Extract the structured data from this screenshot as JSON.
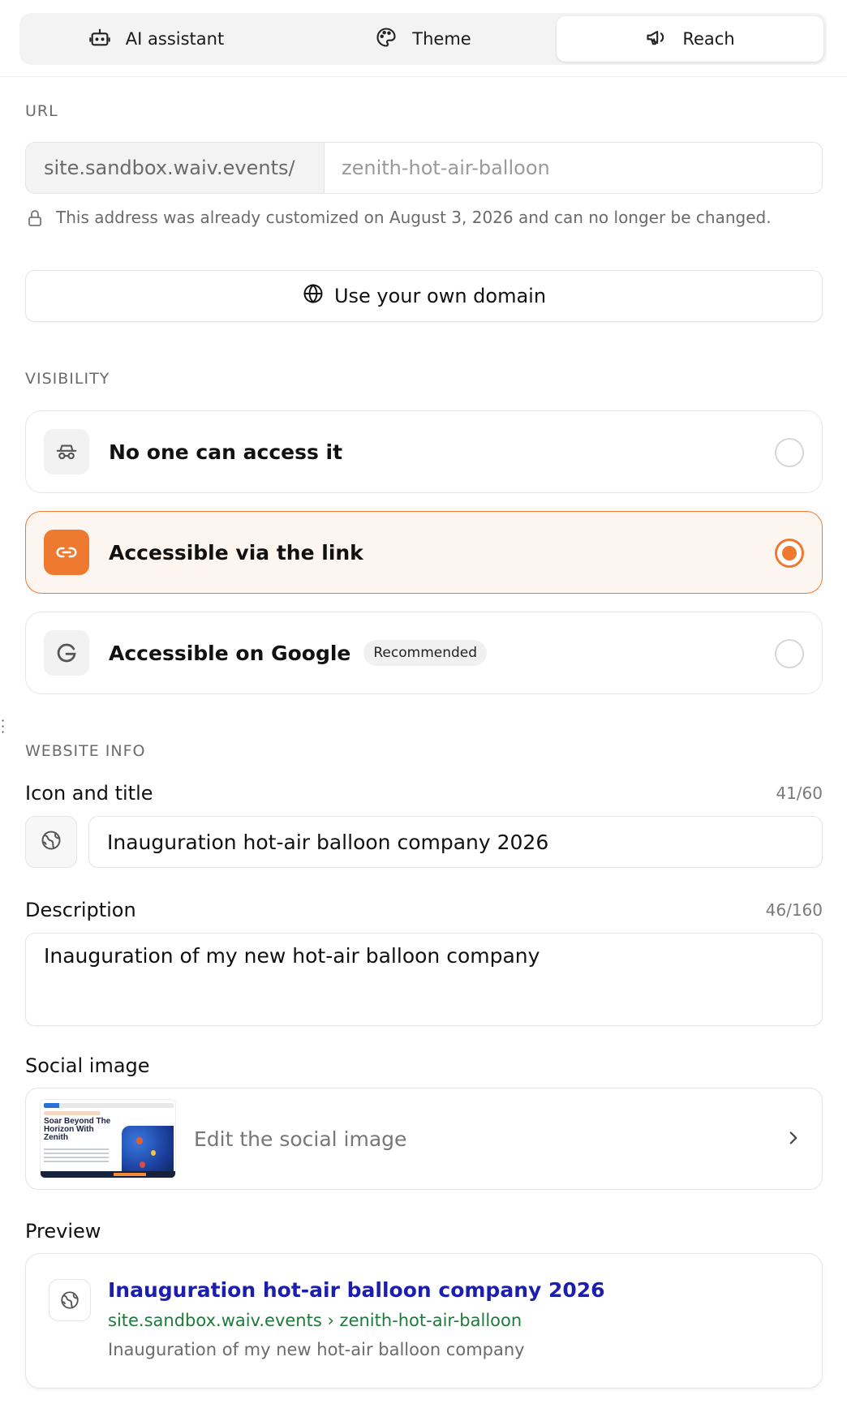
{
  "tabs": [
    {
      "label": "AI assistant",
      "icon": "robot-icon"
    },
    {
      "label": "Theme",
      "icon": "palette-icon"
    },
    {
      "label": "Reach",
      "icon": "megaphone-icon",
      "active": true
    }
  ],
  "url_section": {
    "label": "URL",
    "prefix": "site.sandbox.waiv.events/",
    "slug_placeholder": "zenith-hot-air-balloon",
    "lock_note": "This address was already customized on August 3, 2026 and can no longer be changed.",
    "domain_button": "Use your own domain"
  },
  "visibility": {
    "label": "VISIBILITY",
    "options": [
      {
        "label": "No one can access it",
        "icon": "incognito-icon",
        "selected": false
      },
      {
        "label": "Accessible via the link",
        "icon": "link-icon",
        "selected": true
      },
      {
        "label": "Accessible on Google",
        "icon": "google-icon",
        "badge": "Recommended",
        "selected": false
      }
    ]
  },
  "website_info": {
    "label": "WEBSITE INFO",
    "icon_title_label": "Icon and title",
    "title_counter": "41/60",
    "title_value": "Inauguration hot-air balloon company 2026",
    "description_label": "Description",
    "description_counter": "46/160",
    "description_value": "Inauguration of my new hot-air balloon company",
    "social_image_label": "Social image",
    "social_image_action": "Edit the social image",
    "thumbnail_headline": "Soar Beyond The Horizon With Zenith",
    "preview_label": "Preview",
    "preview": {
      "title": "Inauguration hot-air balloon company 2026",
      "url": "site.sandbox.waiv.events › zenith-hot-air-balloon",
      "description": "Inauguration of my new hot-air balloon company"
    }
  },
  "colors": {
    "accent": "#ee7a32",
    "preview_title": "#1c1fae",
    "preview_url": "#1d7a3b"
  }
}
